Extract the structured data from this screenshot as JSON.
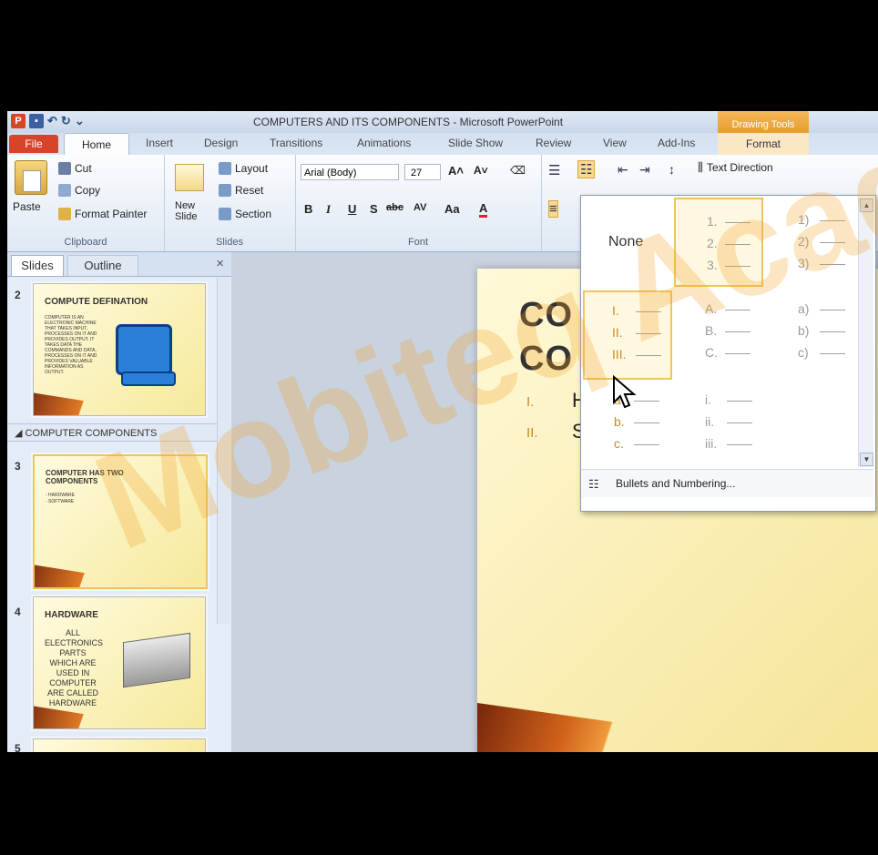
{
  "window": {
    "title": "COMPUTERS AND ITS COMPONENTS  -  Microsoft PowerPoint",
    "contextual_tab_group": "Drawing Tools"
  },
  "tabs": [
    "File",
    "Home",
    "Insert",
    "Design",
    "Transitions",
    "Animations",
    "Slide Show",
    "Review",
    "View",
    "Add-Ins",
    "Format"
  ],
  "ribbon": {
    "clipboard": {
      "paste": "Paste",
      "cut": "Cut",
      "copy": "Copy",
      "format_painter": "Format Painter",
      "label": "Clipboard"
    },
    "slides": {
      "new_slide": "New Slide",
      "layout": "Layout",
      "reset": "Reset",
      "section": "Section",
      "label": "Slides"
    },
    "font": {
      "font_name": "Arial (Body)",
      "font_size": "27",
      "label": "Font",
      "bold": "B",
      "italic": "I",
      "underline": "U",
      "shadow": "S",
      "strike": "abc",
      "spacing": "AV",
      "case": "Aa",
      "color": "A"
    },
    "paragraph": {
      "text_direction": "Text Direction"
    }
  },
  "left_pane": {
    "tabs": {
      "slides": "Slides",
      "outline": "Outline"
    },
    "close": "×",
    "section_name": "COMPUTER COMPONENTS",
    "slides": [
      {
        "num": "2",
        "title": "COMPUTE DEFINATION",
        "body": "COMPUTER IS AN ELECTRONIC MACHINE THAT TAKES INPUT, PROCESSES ON IT AND PROVIDES OUTPUT. IT TAKES DATA THE COMMANDS AND DATA, PROCESSES ON IT AND PROVIDES VALUABLE INFORMATION AS OUTPUT."
      },
      {
        "num": "3",
        "title": "COMPUTER HAS TWO COMPONENTS",
        "body": "- HARDWARE\n- SOFTWARE"
      },
      {
        "num": "4",
        "title": "HARDWARE",
        "body": "ALL ELECTRONICS PARTS WHICH ARE USED IN COMPUTER ARE CALLED HARDWARE"
      },
      {
        "num": "5",
        "title": "",
        "body": ""
      }
    ]
  },
  "slide": {
    "title_line1": "CO",
    "title_line2": "CO",
    "bullets": [
      {
        "num": "I.",
        "text": "H"
      },
      {
        "num": "II.",
        "text": "S"
      }
    ]
  },
  "numbering_gallery": {
    "none": "None",
    "cells": [
      [
        "1.",
        "2.",
        "3."
      ],
      [
        "1)",
        "2)",
        "3)"
      ],
      [
        "I.",
        "II.",
        "III."
      ],
      [
        "A.",
        "B.",
        "C."
      ],
      [
        "a)",
        "b)",
        "c)"
      ],
      [
        "a.",
        "b.",
        "c."
      ],
      [
        "i.",
        "ii.",
        "iii."
      ]
    ],
    "footer": "Bullets and Numbering..."
  },
  "watermark": "Mobiteq Academy",
  "colors": {
    "accent": "#d24726",
    "selection": "#f0c45a",
    "slide_bg": "#fbf0b8"
  }
}
